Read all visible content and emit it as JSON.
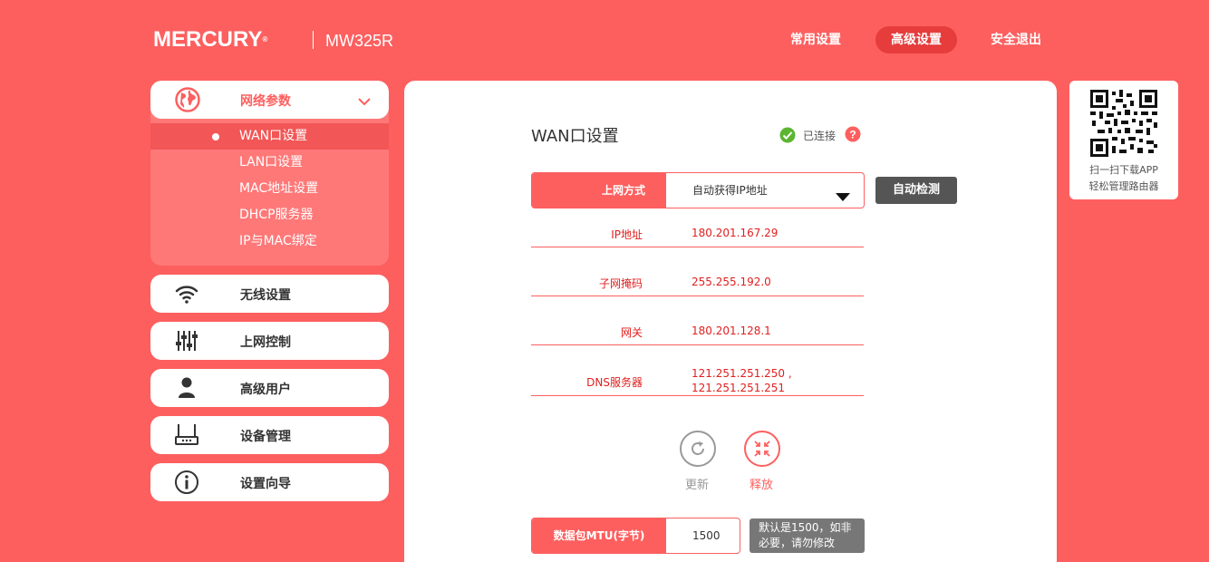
{
  "header": {
    "brand": "MERCURY",
    "brand_mark": "®",
    "model": "MW325R",
    "nav": [
      {
        "label": "常用设置",
        "active": false
      },
      {
        "label": "高级设置",
        "active": true
      },
      {
        "label": "安全退出",
        "active": false
      }
    ]
  },
  "sidebar": {
    "network": {
      "label": "网络参数",
      "icon": "globe-icon",
      "items": [
        {
          "label": "WAN口设置",
          "active": true
        },
        {
          "label": "LAN口设置",
          "active": false
        },
        {
          "label": "MAC地址设置",
          "active": false
        },
        {
          "label": "DHCP服务器",
          "active": false
        },
        {
          "label": "IP与MAC绑定",
          "active": false
        }
      ]
    },
    "items": [
      {
        "label": "无线设置",
        "icon": "wifi-icon"
      },
      {
        "label": "上网控制",
        "icon": "sliders-icon"
      },
      {
        "label": "高级用户",
        "icon": "user-icon"
      },
      {
        "label": "设备管理",
        "icon": "router-icon"
      },
      {
        "label": "设置向导",
        "icon": "info-icon"
      }
    ]
  },
  "main": {
    "title": "WAN口设置",
    "status": "已连接",
    "wan_type_label": "上网方式",
    "wan_type_value": "自动获得IP地址",
    "detect_button": "自动检测",
    "info": [
      {
        "key": "IP地址",
        "value": "180.201.167.29"
      },
      {
        "key": "子网掩码",
        "value": "255.255.192.0"
      },
      {
        "key": "网关",
        "value": "180.201.128.1"
      },
      {
        "key": "DNS服务器",
        "value": "121.251.251.250 ,",
        "value2": "121.251.251.251"
      }
    ],
    "renew_label": "更新",
    "release_label": "释放",
    "mtu_label": "数据包MTU(字节)",
    "mtu_value": "1500",
    "mtu_note": "默认是1500，如非必要，请勿修改"
  },
  "qr": {
    "line1": "扫一扫下载APP",
    "line2": "轻松管理路由器"
  },
  "colors": {
    "accent": "#fd5f5f",
    "accent_dark": "#e63c3c",
    "ok": "#5cb531",
    "button_dark": "#555555"
  }
}
